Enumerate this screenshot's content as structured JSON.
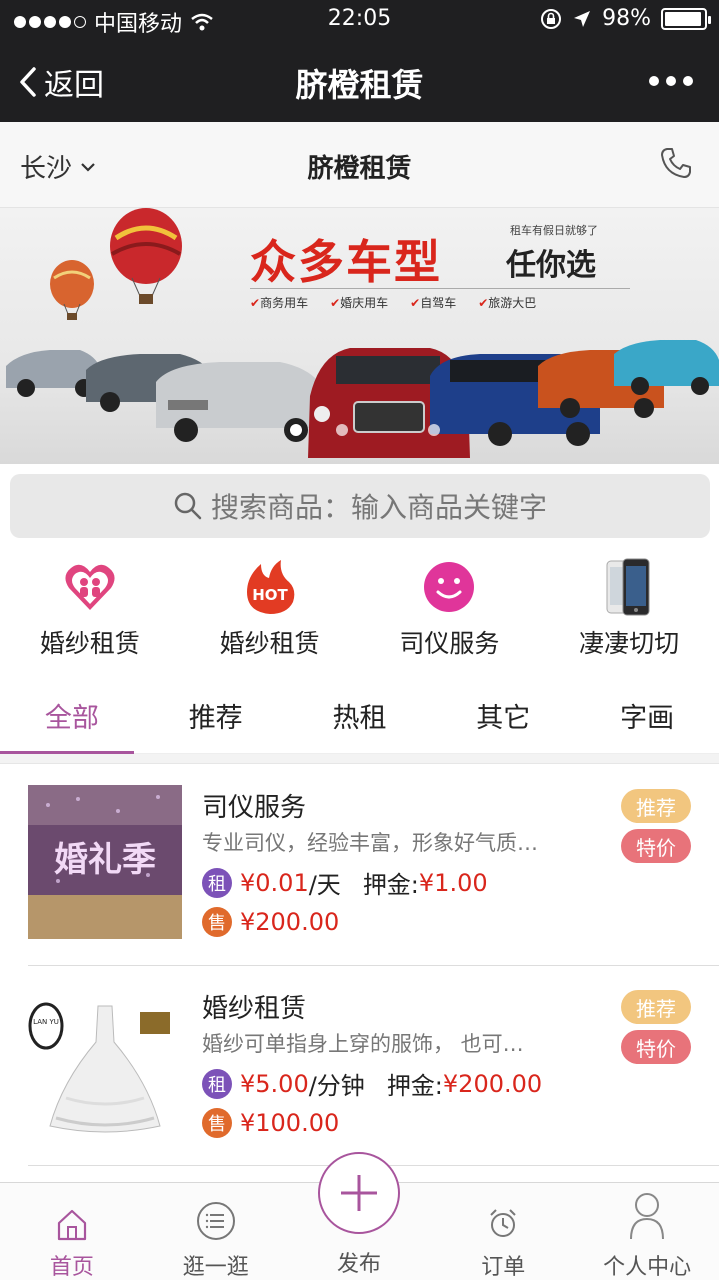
{
  "status_bar": {
    "carrier": "中国移动",
    "time": "22:05",
    "battery": "98%"
  },
  "nav": {
    "back_label": "返回",
    "title": "脐橙租赁"
  },
  "city_bar": {
    "city": "长沙",
    "title": "脐橙租赁"
  },
  "banner": {
    "headline": "众多车型",
    "sub": "任你选",
    "tiny": "租车有假日就够了",
    "tags": [
      "商务用车",
      "婚庆用车",
      "自驾车",
      "旅游大巴"
    ],
    "slide_current": 1,
    "slide_total": 2
  },
  "search": {
    "placeholder": "搜索商品：输入商品关键字"
  },
  "categories": [
    {
      "label": "婚纱租赁",
      "icon": "heart-couple-icon"
    },
    {
      "label": "婚纱租赁",
      "icon": "hot-flame-icon"
    },
    {
      "label": "司仪服务",
      "icon": "smiley-icon"
    },
    {
      "label": "凄凄切切",
      "icon": "phone-product-icon"
    }
  ],
  "tabs": [
    "全部",
    "推荐",
    "热租",
    "其它",
    "字画"
  ],
  "active_tab": 0,
  "items": [
    {
      "name": "司仪服务",
      "desc": "专业司仪，经验丰富，形象好气质…",
      "rent_badge": "租",
      "rent_price": "¥0.01",
      "rent_unit": "/天",
      "deposit_label": "押金:",
      "deposit_price": "¥1.00",
      "sell_badge": "售",
      "sell_price": "¥200.00",
      "tag1": "推荐",
      "tag2": "特价",
      "thumb_text": "婚礼季"
    },
    {
      "name": "婚纱租赁",
      "desc": "婚纱可单指身上穿的服饰， 也可…",
      "rent_badge": "租",
      "rent_price": "¥5.00",
      "rent_unit": "/分钟",
      "deposit_label": "押金:",
      "deposit_price": "¥200.00",
      "sell_badge": "售",
      "sell_price": "¥100.00",
      "tag1": "推荐",
      "tag2": "特价",
      "thumb_text": "LAN YU"
    }
  ],
  "bottom_nav": [
    {
      "label": "首页",
      "icon": "home-icon"
    },
    {
      "label": "逛一逛",
      "icon": "list-circle-icon"
    },
    {
      "label": "发布",
      "icon": "plus-icon"
    },
    {
      "label": "订单",
      "icon": "alarm-clock-icon"
    },
    {
      "label": "个人中心",
      "icon": "person-icon"
    }
  ],
  "colors": {
    "accent": "#a8559d",
    "price_red": "#d9261c",
    "rent_badge": "#7c52b8",
    "sell_badge": "#e06a2c",
    "tag_recommend": "#f2c67f",
    "tag_sale": "#e8737a"
  }
}
